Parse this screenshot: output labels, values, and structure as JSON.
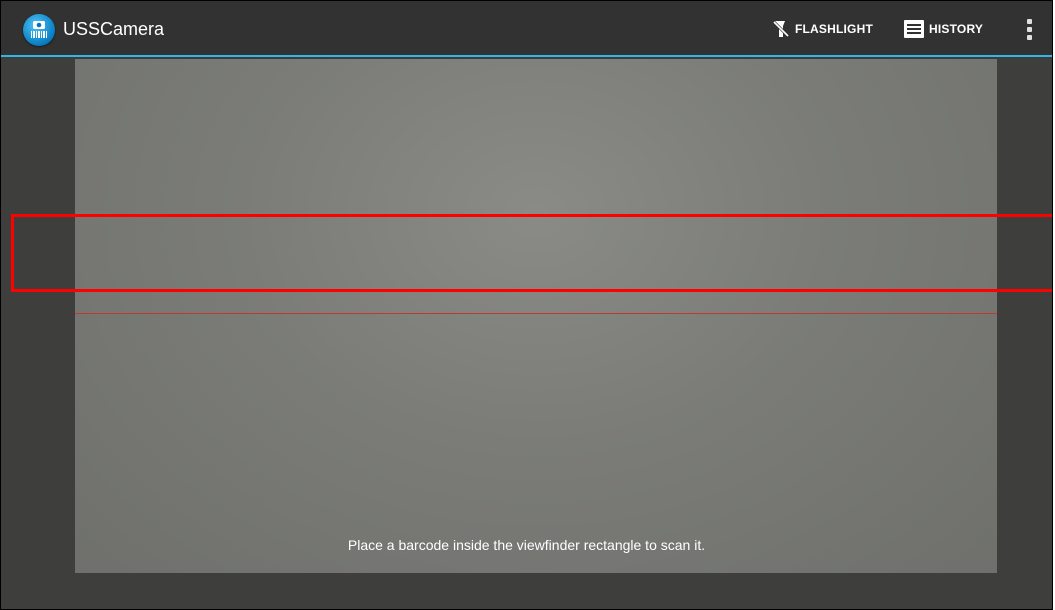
{
  "app": {
    "title": "USSCamera",
    "icon": "barcode-camera-icon"
  },
  "toolbar": {
    "flashlight_label": "FLASHLIGHT",
    "flashlight_icon": "flashlight-off-icon",
    "history_label": "HISTORY",
    "history_icon": "history-list-icon",
    "overflow_icon": "more-vert-icon"
  },
  "scanner": {
    "status_text": "Place a barcode inside the viewfinder rectangle to scan it."
  },
  "colors": {
    "action_bar_bg": "#323232",
    "accent": "#33b5e5",
    "laser": "#c0392b",
    "highlight": "#ff0000"
  }
}
